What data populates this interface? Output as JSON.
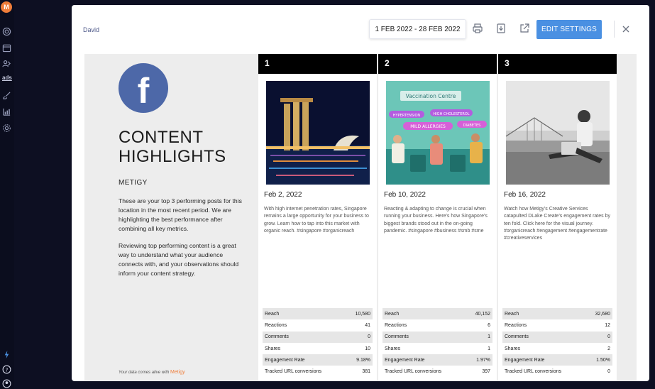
{
  "rail": {
    "logo": "M",
    "ads_label": "ads"
  },
  "modal": {
    "account_name": "David",
    "date_range": "1 FEB 2022 - 28 FEB 2022",
    "edit_button": "EDIT SETTINGS"
  },
  "report": {
    "title": "CONTENT\nHIGHLIGHTS",
    "brand": "METIGY",
    "intro": "These are your top 3 performing posts for this location in the most recent period. We are highlighting the best performance after combining all key metrics.",
    "intro2": "Reviewing top performing content is a great way to understand what your audience connects with, and your observations should inform your content strategy.",
    "footnote_text": "Your data comes alive with",
    "footnote_brand": "Metigy",
    "image_texts": {
      "sign": "Vaccination Centre",
      "tag1": "HYPERTENSION",
      "tag2": "HIGH CHOLESTEROL",
      "tag3": "MILD ALLERGIES",
      "tag4": "DIABETES"
    },
    "posts": [
      {
        "rank": "1",
        "date": "Feb 2, 2022",
        "description": "With high internet penetration rates, Singapore remains a large opportunity for your business to grow. Learn how to tap into this market with organic reach. #singapore #organicreach",
        "stats": [
          {
            "label": "Reach",
            "value": "10,580"
          },
          {
            "label": "Reactions",
            "value": "41"
          },
          {
            "label": "Comments",
            "value": "0"
          },
          {
            "label": "Shares",
            "value": "10"
          },
          {
            "label": "Engagement Rate",
            "value": "9.18%"
          },
          {
            "label": "Tracked URL conversions",
            "value": "381"
          }
        ]
      },
      {
        "rank": "2",
        "date": "Feb 10, 2022",
        "description": "Reacting & adapting to change is crucial when running your business. Here's how Singapore's biggest brands stood out in the on-going pandemic. #singapore #business #smb #sme",
        "stats": [
          {
            "label": "Reach",
            "value": "40,152"
          },
          {
            "label": "Reactions",
            "value": "6"
          },
          {
            "label": "Comments",
            "value": "1"
          },
          {
            "label": "Shares",
            "value": "1"
          },
          {
            "label": "Engagement Rate",
            "value": "1.97%"
          },
          {
            "label": "Tracked URL conversions",
            "value": "397"
          }
        ]
      },
      {
        "rank": "3",
        "date": "Feb 16, 2022",
        "description": "Watch how Metigy's Creative Services catapulted DLake Create's engagement rates by ten fold. Click here for the visual journey. #organicreach #engagement #engagementrate #creativeservices",
        "stats": [
          {
            "label": "Reach",
            "value": "32,680"
          },
          {
            "label": "Reactions",
            "value": "12"
          },
          {
            "label": "Comments",
            "value": "0"
          },
          {
            "label": "Shares",
            "value": "2"
          },
          {
            "label": "Engagement Rate",
            "value": "1.50%"
          },
          {
            "label": "Tracked URL conversions",
            "value": "0"
          }
        ]
      }
    ]
  },
  "colors": {
    "accent_blue": "#4a90e2",
    "facebook_blue": "#4d68a8",
    "brand_orange": "#ef7d3a"
  }
}
